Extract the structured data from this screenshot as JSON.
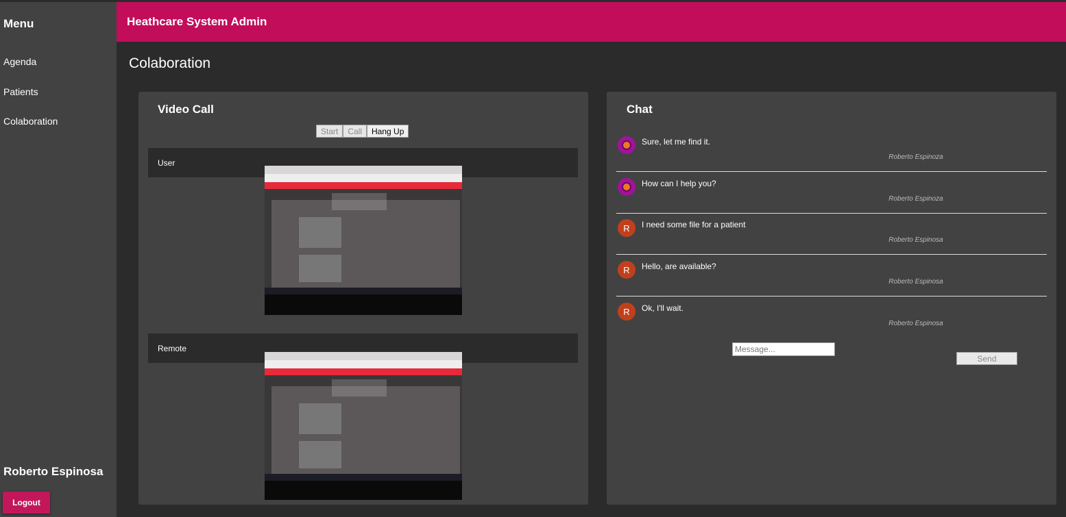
{
  "sidebar": {
    "title": "Menu",
    "items": [
      {
        "label": "Agenda"
      },
      {
        "label": "Patients"
      },
      {
        "label": "Colaboration"
      }
    ],
    "user_name": "Roberto Espinosa",
    "logout_label": "Logout"
  },
  "header": {
    "title": "Heathcare System Admin",
    "color": "#c20d5b"
  },
  "page": {
    "title": "Colaboration"
  },
  "video_call": {
    "title": "Video Call",
    "buttons": [
      {
        "label": "Start",
        "enabled": false
      },
      {
        "label": "Call",
        "enabled": false
      },
      {
        "label": "Hang Up",
        "enabled": true
      }
    ],
    "user_label": "User",
    "remote_label": "Remote"
  },
  "chat": {
    "title": "Chat",
    "messages": [
      {
        "text": "Sure, let me find it.",
        "author": "Roberto Espinoza",
        "avatar": "logo"
      },
      {
        "text": "How can I help you?",
        "author": "Roberto Espinoza",
        "avatar": "logo"
      },
      {
        "text": "I need some file for a patient",
        "author": "Roberto Espinosa",
        "avatar": "R"
      },
      {
        "text": "Hello, are available?",
        "author": "Roberto Espinosa",
        "avatar": "R"
      },
      {
        "text": "Ok, I'll wait.",
        "author": "Roberto Espinosa",
        "avatar": "R"
      }
    ],
    "input_placeholder": "Message...",
    "input_value": "",
    "send_label": "Send"
  }
}
